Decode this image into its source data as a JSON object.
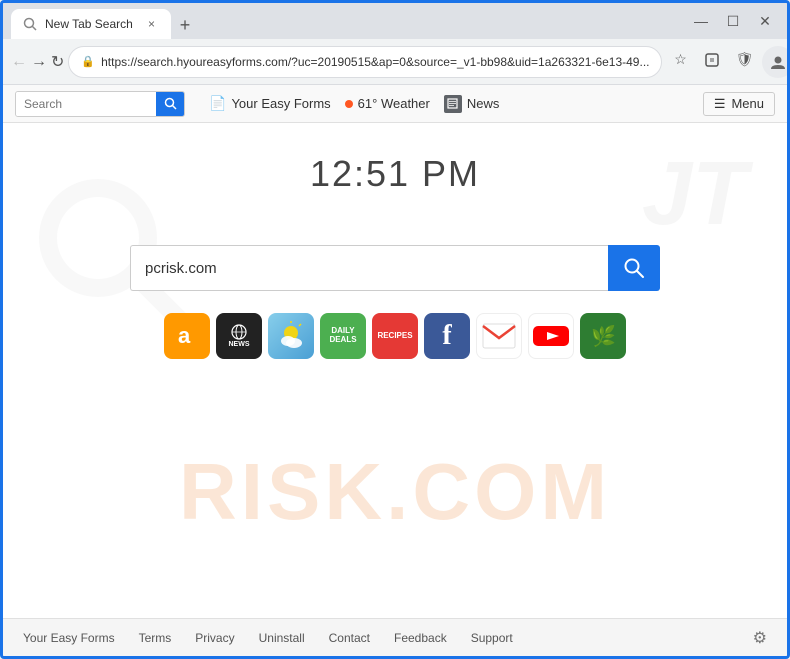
{
  "browser": {
    "tab": {
      "title": "New Tab Search",
      "close_label": "×"
    },
    "new_tab_label": "+",
    "window_controls": {
      "minimize": "—",
      "maximize": "☐",
      "close": "✕"
    },
    "address_bar": {
      "url": "https://search.hyoureasyforms.com/?uc=20190515&ap=0&source=_v1-bb98&uid=1a263321-6e13-49...",
      "lock_icon": "🔒"
    }
  },
  "toolbar": {
    "search_placeholder": "Search",
    "search_icon": "🔍",
    "nav_items": [
      {
        "id": "easy-forms",
        "icon": "📄",
        "label": "Your Easy Forms"
      },
      {
        "id": "weather",
        "dot": true,
        "label": "61° Weather"
      },
      {
        "id": "news",
        "icon": "📰",
        "label": "News"
      }
    ],
    "menu_icon": "☰",
    "menu_label": "Menu"
  },
  "page": {
    "clock": "12:51 PM",
    "search_value": "pcrisk.com",
    "search_placeholder": "",
    "search_btn_icon": "🔍"
  },
  "shortcuts": [
    {
      "id": "amazon",
      "label": "a",
      "style": "amazon"
    },
    {
      "id": "news",
      "label": "NEWS",
      "style": "news"
    },
    {
      "id": "weather",
      "label": "☁",
      "style": "weather"
    },
    {
      "id": "deals",
      "label": "DAILY DEALS",
      "style": "deals"
    },
    {
      "id": "recipes",
      "label": "RECIPES",
      "style": "recipes"
    },
    {
      "id": "facebook",
      "label": "f",
      "style": "facebook"
    },
    {
      "id": "gmail",
      "label": "M",
      "style": "gmail"
    },
    {
      "id": "youtube",
      "label": "You Tube",
      "style": "youtube"
    },
    {
      "id": "last",
      "label": "🌿",
      "style": "last"
    }
  ],
  "footer": {
    "links": [
      {
        "id": "easy-forms",
        "label": "Your Easy Forms"
      },
      {
        "id": "terms",
        "label": "Terms"
      },
      {
        "id": "privacy",
        "label": "Privacy"
      },
      {
        "id": "uninstall",
        "label": "Uninstall"
      },
      {
        "id": "contact",
        "label": "Contact"
      },
      {
        "id": "feedback",
        "label": "Feedback"
      },
      {
        "id": "support",
        "label": "Support"
      }
    ],
    "gear_icon": "⚙"
  },
  "watermark": {
    "text": "RISK.COM"
  }
}
